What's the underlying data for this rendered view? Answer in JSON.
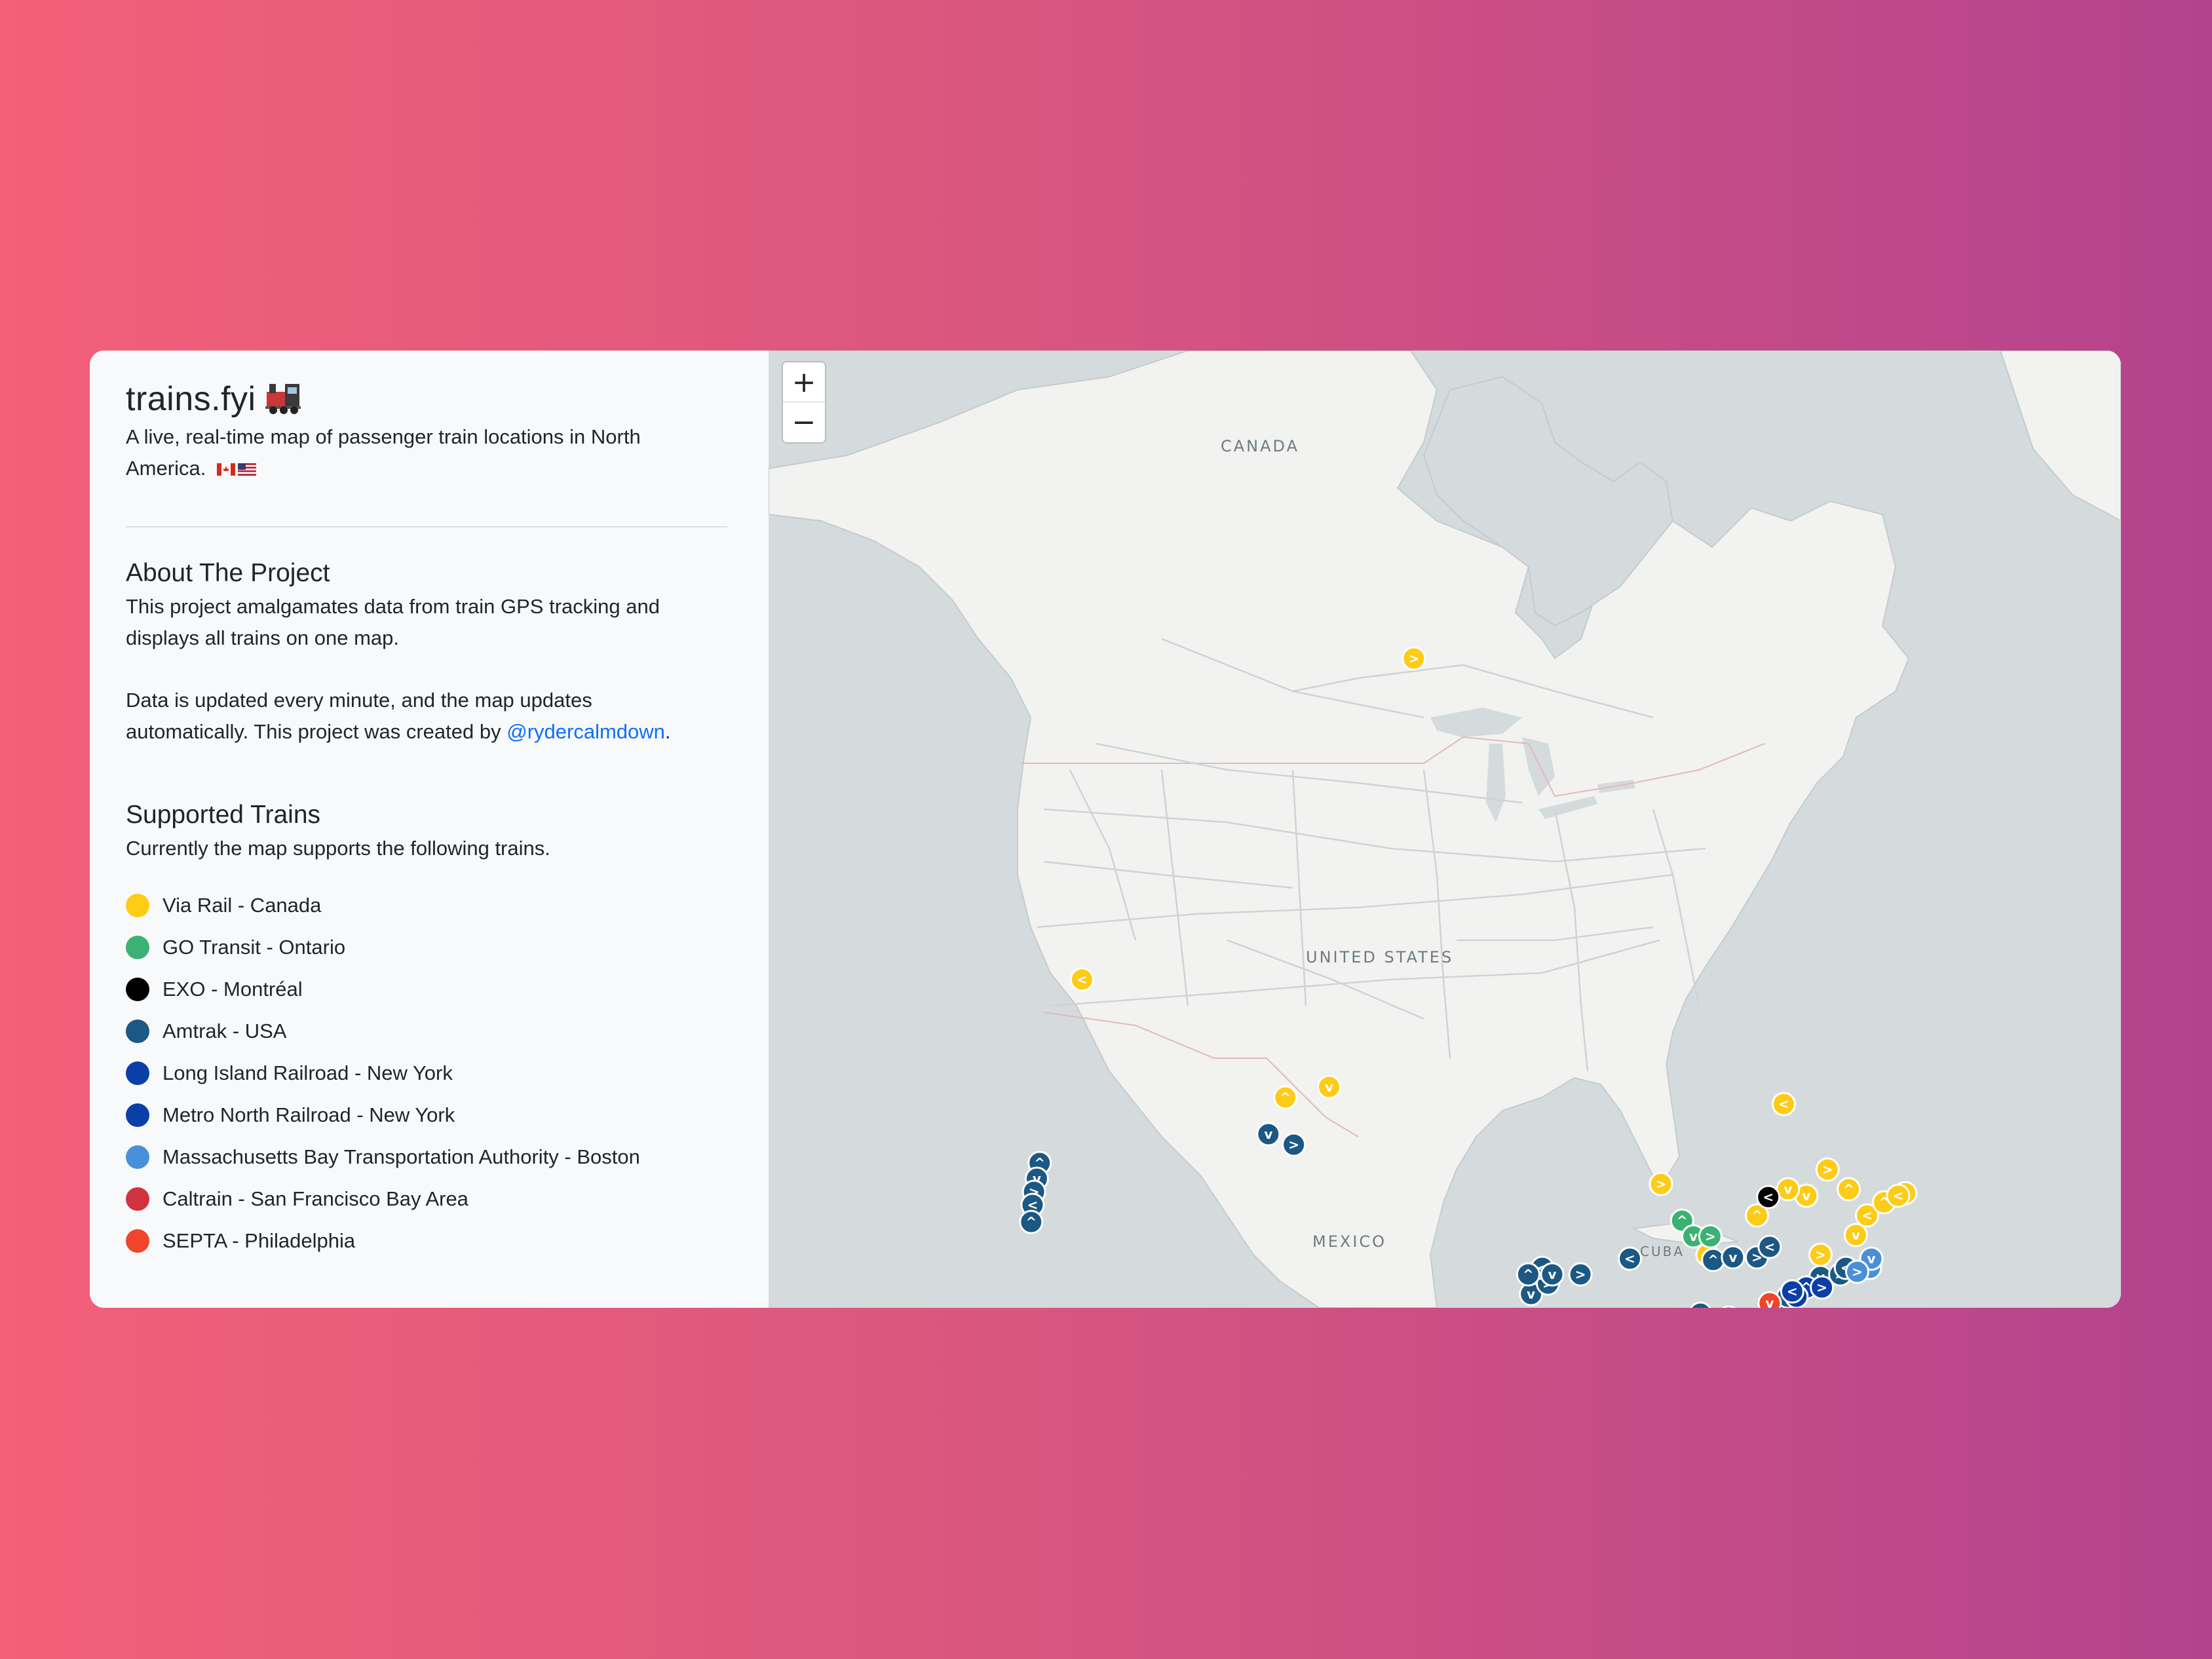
{
  "site": {
    "title": "trains.fyi",
    "subtitle": "A live, real-time map of passenger train locations in North America."
  },
  "about": {
    "heading": "About The Project",
    "paragraph1": "This project amalgamates data from train GPS tracking and displays all trains on one map.",
    "paragraph2_prefix": "Data is updated every minute, and the map updates automatically. This project was created by ",
    "author_link": "@rydercalmdown",
    "paragraph2_suffix": "."
  },
  "supported": {
    "heading": "Supported Trains",
    "intro": "Currently the map supports the following trains.",
    "items": [
      {
        "label": "Via Rail - Canada",
        "color": "#fecb16"
      },
      {
        "label": "GO Transit - Ontario",
        "color": "#3bb273"
      },
      {
        "label": "EXO - Montréal",
        "color": "#000000"
      },
      {
        "label": "Amtrak - USA",
        "color": "#1b5883"
      },
      {
        "label": "Long Island Railroad - New York",
        "color": "#0b3fa8"
      },
      {
        "label": "Metro North Railroad - New York",
        "color": "#0b3fa8"
      },
      {
        "label": "Massachusetts Bay Transportation Authority - Boston",
        "color": "#4a90d9"
      },
      {
        "label": "Caltrain - San Francisco Bay Area",
        "color": "#d0333f"
      },
      {
        "label": "SEPTA - Philadelphia",
        "color": "#f0452a"
      }
    ]
  },
  "map": {
    "zoom_in": "+",
    "zoom_out": "−",
    "labels": {
      "canada": "CANADA",
      "usa": "UNITED STATES",
      "mexico": "MEXICO",
      "cuba": "CUBA"
    }
  }
}
